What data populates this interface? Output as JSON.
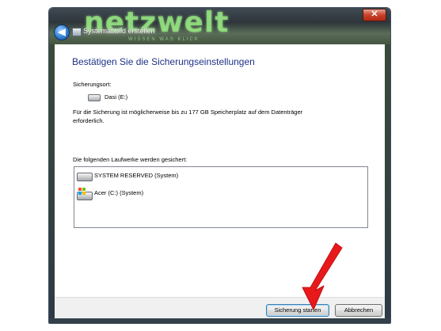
{
  "window": {
    "title": "Systemabbild erstellen",
    "close_glyph": "✕",
    "back_glyph": "◀",
    "watermark": "netzwelt",
    "watermark_sub": "WISSEN WAS KLICK"
  },
  "content": {
    "heading": "Bestätigen Sie die Sicherungseinstellungen",
    "location_label": "Sicherungsort:",
    "destination_drive": "Dasi (E:)",
    "info_text": "Für die Sicherung ist möglicherweise bis zu 177 GB Speicherplatz auf dem Datenträger erforderlich.",
    "drives_label": "Die folgenden Laufwerke werden gesichert:",
    "drives": [
      {
        "label": "SYSTEM RESERVED (System)",
        "icon": "hard-drive-icon"
      },
      {
        "label": "Acer (C:) (System)",
        "icon": "windows-drive-icon"
      }
    ]
  },
  "buttons": {
    "start": "Sicherung starten",
    "cancel": "Abbrechen"
  },
  "colors": {
    "heading": "#1e3287",
    "annotation_arrow": "#e8191b"
  }
}
